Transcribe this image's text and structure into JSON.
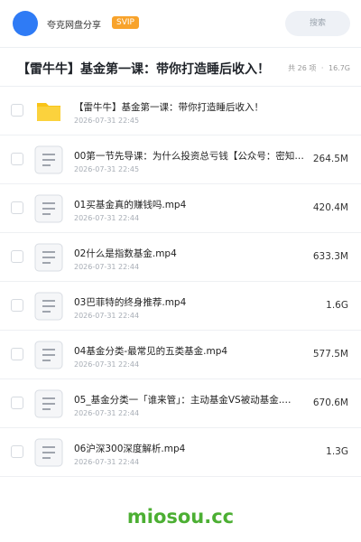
{
  "header": {
    "app_name": "夸克网盘分享",
    "badge": "SVIP",
    "search_placeholder": "搜索",
    "avatar_color": "#2f7bf5"
  },
  "folder": {
    "title": "【雷牛牛】基金第一课：带你打造睡后收入！",
    "count": "共 26 项",
    "size": "16.7G"
  },
  "items": [
    {
      "type": "folder",
      "icon": "folder-icon",
      "name": "【雷牛牛】基金第一课：带你打造睡后收入！",
      "date": "2026-07-31 22:45",
      "size": ""
    },
    {
      "type": "file",
      "icon": "file-icon",
      "name": "00第一节先导课：为什么投资总亏钱【公众号：密知圈…",
      "date": "2026-07-31 22:45",
      "size": "264.5M"
    },
    {
      "type": "file",
      "icon": "file-icon",
      "name": "01买基金真的赚钱吗.mp4",
      "date": "2026-07-31 22:44",
      "size": "420.4M"
    },
    {
      "type": "file",
      "icon": "file-icon",
      "name": "02什么是指数基金.mp4",
      "date": "2026-07-31 22:44",
      "size": "633.3M"
    },
    {
      "type": "file",
      "icon": "file-icon",
      "name": "03巴菲特的终身推荐.mp4",
      "date": "2026-07-31 22:44",
      "size": "1.6G"
    },
    {
      "type": "file",
      "icon": "file-icon",
      "name": "04基金分类-最常见的五类基金.mp4",
      "date": "2026-07-31 22:44",
      "size": "577.5M"
    },
    {
      "type": "file",
      "icon": "file-icon",
      "name": "05_基金分类一「谁来管」：主动基金VS被动基金.…",
      "date": "2026-07-31 22:44",
      "size": "670.6M"
    },
    {
      "type": "file",
      "icon": "file-icon",
      "name": "06沪深300深度解析.mp4",
      "date": "2026-07-31 22:44",
      "size": "1.3G"
    }
  ],
  "watermark": "miosou.cc",
  "colors": {
    "accent": "#2f7bf5",
    "svip": "#f8a32b",
    "folder": "#f9c418",
    "watermark": "#4caf33"
  }
}
